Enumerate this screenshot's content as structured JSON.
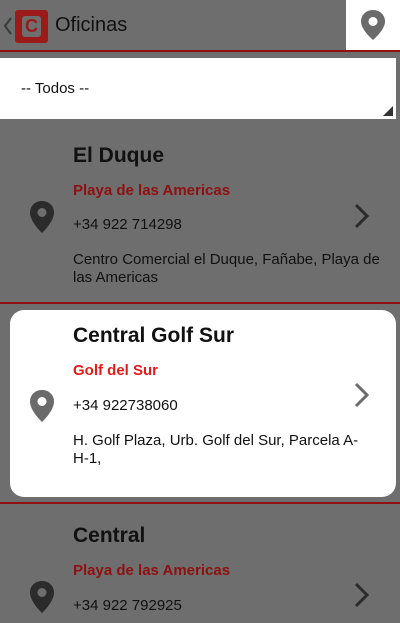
{
  "header": {
    "back_icon": "chevron-left-icon",
    "logo_icon": "app-logo-icon",
    "logo_letter": "C",
    "title": "Oficinas",
    "map_icon": "map-pin-icon"
  },
  "filter": {
    "selected": "-- Todos --"
  },
  "offices": [
    {
      "name": "El Duque",
      "area": "Playa de las Americas",
      "phone": "+34 922 714298",
      "address": "Centro Comercial el Duque, Fañabe, Playa de las Americas",
      "icon": "map-pin-icon"
    },
    {
      "name": "Central Golf Sur",
      "area": "Golf del Sur",
      "phone": "+34 922738060",
      "address": "H. Golf Plaza, Urb. Golf del Sur, Parcela A-H-1,",
      "icon": "map-pin-icon"
    },
    {
      "name": "Central",
      "area": "Playa de las Americas",
      "phone": "+34 922 792925",
      "address": "",
      "icon": "map-pin-icon"
    }
  ],
  "colors": {
    "accent": "#9b1a1a",
    "area_text_dim": "#8f1010",
    "area_text_active": "#e31b1b",
    "overlay": "#6e6e6e"
  }
}
